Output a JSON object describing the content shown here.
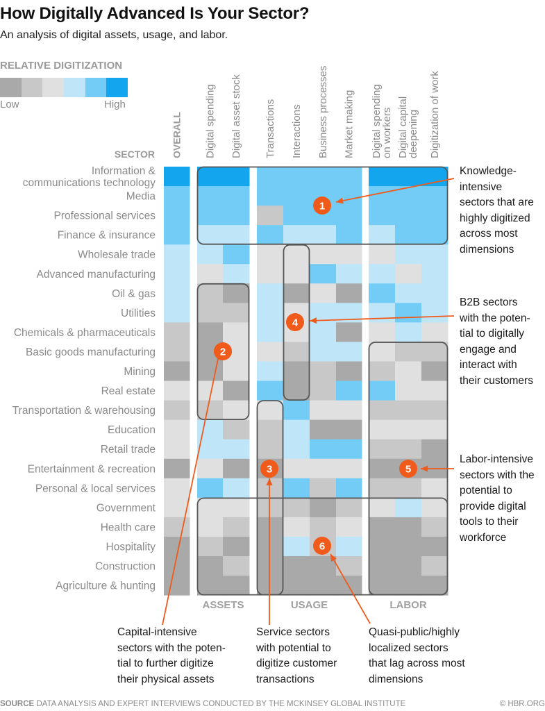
{
  "header": {
    "title": "How Digitally Advanced Is Your Sector?",
    "subtitle": "An analysis of digital assets, usage, and labor."
  },
  "legend": {
    "title": "RELATIVE DIGITIZATION",
    "low_label": "Low",
    "high_label": "High",
    "colors": [
      "#a9a9a9",
      "#c8c8c8",
      "#e0e0e0",
      "#bfe6f8",
      "#72ccf6",
      "#13a6ee"
    ]
  },
  "accent_color": "#f05a1a",
  "chart_data": {
    "type": "heatmap",
    "title": "How Digitally Advanced Is Your Sector?",
    "subtitle": "An analysis of digital assets, usage, and labor.",
    "scale": "1 = Low digitization ... 6 = High digitization (relative)",
    "row_axis_label": "SECTOR",
    "rows": [
      "Information & communications technology",
      "Media",
      "Professional services",
      "Finance & insurance",
      "Wholesale trade",
      "Advanced manufacturing",
      "Oil & gas",
      "Utilities",
      "Chemicals & pharmaceuticals",
      "Basic goods manufacturing",
      "Mining",
      "Real estate",
      "Transportation & warehousing",
      "Education",
      "Retail trade",
      "Entertainment & recreation",
      "Personal & local services",
      "Government",
      "Health care",
      "Hospitality",
      "Construction",
      "Agriculture & hunting"
    ],
    "row_labels_display": [
      [
        "Information &",
        "communications technology"
      ],
      [
        "Media"
      ],
      [
        "Professional services"
      ],
      [
        "Finance & insurance"
      ],
      [
        "Wholesale trade"
      ],
      [
        "Advanced manufacturing"
      ],
      [
        "Oil & gas"
      ],
      [
        "Utilities"
      ],
      [
        "Chemicals & pharmaceuticals"
      ],
      [
        "Basic goods manufacturing"
      ],
      [
        "Mining"
      ],
      [
        "Real estate"
      ],
      [
        "Transportation & warehousing"
      ],
      [
        "Education"
      ],
      [
        "Retail trade"
      ],
      [
        "Entertainment & recreation"
      ],
      [
        "Personal & local services"
      ],
      [
        "Government"
      ],
      [
        "Health care"
      ],
      [
        "Hospitality"
      ],
      [
        "Construction"
      ],
      [
        "Agriculture & hunting"
      ]
    ],
    "columns": [
      {
        "label": [
          "OVERALL"
        ],
        "group": "overall"
      },
      {
        "label": [
          "Digital spending"
        ],
        "group": "ASSETS"
      },
      {
        "label": [
          "Digital asset stock"
        ],
        "group": "ASSETS"
      },
      {
        "label": [
          "Transactions"
        ],
        "group": "USAGE"
      },
      {
        "label": [
          "Interactions"
        ],
        "group": "USAGE"
      },
      {
        "label": [
          "Business processes"
        ],
        "group": "USAGE"
      },
      {
        "label": [
          "Market making"
        ],
        "group": "USAGE"
      },
      {
        "label": [
          "Digital spending",
          "on workers"
        ],
        "group": "LABOR"
      },
      {
        "label": [
          "Digital capital",
          "deepening"
        ],
        "group": "LABOR"
      },
      {
        "label": [
          "Digitization of work"
        ],
        "group": "LABOR"
      }
    ],
    "groups": [
      "ASSETS",
      "USAGE",
      "LABOR"
    ],
    "values": [
      [
        6,
        6,
        6,
        5,
        5,
        5,
        5,
        6,
        6,
        6
      ],
      [
        5,
        5,
        5,
        5,
        5,
        5,
        5,
        5,
        5,
        5
      ],
      [
        5,
        5,
        5,
        2,
        5,
        5,
        5,
        5,
        5,
        5
      ],
      [
        5,
        4,
        4,
        5,
        4,
        4,
        5,
        4,
        5,
        5
      ],
      [
        4,
        4,
        5,
        3,
        3,
        3,
        3,
        3,
        4,
        4
      ],
      [
        4,
        3,
        4,
        3,
        3,
        5,
        4,
        4,
        3,
        4
      ],
      [
        4,
        2,
        1,
        4,
        1,
        3,
        1,
        5,
        4,
        4
      ],
      [
        4,
        2,
        2,
        4,
        3,
        4,
        4,
        4,
        5,
        4
      ],
      [
        2,
        1,
        3,
        4,
        3,
        4,
        1,
        3,
        4,
        3
      ],
      [
        2,
        1,
        3,
        3,
        2,
        4,
        4,
        3,
        2,
        2
      ],
      [
        1,
        1,
        3,
        4,
        1,
        2,
        1,
        2,
        3,
        1
      ],
      [
        3,
        3,
        1,
        5,
        1,
        2,
        5,
        5,
        3,
        3
      ],
      [
        2,
        2,
        3,
        3,
        5,
        3,
        3,
        2,
        2,
        2
      ],
      [
        3,
        4,
        2,
        2,
        4,
        1,
        1,
        3,
        3,
        3
      ],
      [
        3,
        4,
        4,
        2,
        4,
        5,
        5,
        2,
        2,
        1
      ],
      [
        1,
        3,
        1,
        1,
        3,
        3,
        3,
        1,
        1,
        1
      ],
      [
        3,
        5,
        4,
        2,
        5,
        2,
        5,
        2,
        2,
        3
      ],
      [
        3,
        3,
        3,
        2,
        2,
        1,
        2,
        3,
        4,
        3
      ],
      [
        2,
        3,
        2,
        1,
        3,
        2,
        3,
        1,
        1,
        2
      ],
      [
        1,
        2,
        1,
        1,
        4,
        2,
        4,
        1,
        1,
        1
      ],
      [
        1,
        1,
        2,
        1,
        1,
        1,
        2,
        1,
        1,
        2
      ],
      [
        1,
        1,
        1,
        1,
        1,
        1,
        1,
        1,
        1,
        1
      ]
    ],
    "callouts": [
      {
        "number": "1",
        "rows": [
          0,
          3
        ],
        "cols": [
          1,
          9
        ],
        "text": "Knowledge-\nintensive\nsectors that are\nhighly digitized\nacross most\ndimensions"
      },
      {
        "number": "2",
        "rows": [
          6,
          12
        ],
        "cols": [
          1,
          2
        ],
        "text": "Capital-intensive\nsectors with the poten-\ntial to further digitize\ntheir physical assets"
      },
      {
        "number": "3",
        "rows": [
          12,
          21
        ],
        "cols": [
          3,
          3
        ],
        "text": "Service sectors\nwith potential to\ndigitize customer\ntransactions"
      },
      {
        "number": "4",
        "rows": [
          4,
          11
        ],
        "cols": [
          4,
          4
        ],
        "text": "B2B sectors\nwith the poten-\ntial to digitally\nengage and\ninteract with\ntheir customers"
      },
      {
        "number": "5",
        "rows": [
          9,
          21
        ],
        "cols": [
          7,
          9
        ],
        "text": "Labor-intensive\nsectors with the\npotential to\nprovide digital\ntools to their\nworkforce"
      },
      {
        "number": "6",
        "rows": [
          17,
          21
        ],
        "cols": [
          1,
          9
        ],
        "text": "Quasi-public/highly\nlocalized sectors\nthat lag across most\ndimensions"
      }
    ]
  },
  "footer": {
    "source_label": "SOURCE",
    "source_text": "DATA ANALYSIS AND EXPERT INTERVIEWS CONDUCTED BY THE MCKINSEY GLOBAL INSTITUTE",
    "copyright": "© HBR.ORG"
  }
}
